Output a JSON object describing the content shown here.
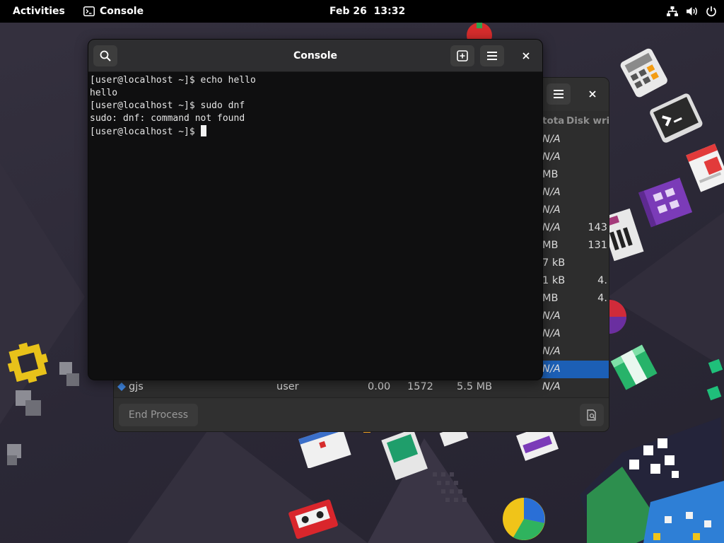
{
  "topbar": {
    "activities": "Activities",
    "app_name": "Console",
    "date": "Feb 26",
    "time": "13:32",
    "tray_icons": [
      "network-icon",
      "volume-icon",
      "power-icon"
    ]
  },
  "console": {
    "title": "Console",
    "lines": [
      "[user@localhost ~]$ echo hello",
      "hello",
      "[user@localhost ~]$ sudo dnf",
      "sudo: dnf: command not found",
      "[user@localhost ~]$ "
    ]
  },
  "sysmon": {
    "header_disk": "tota",
    "header_write": "Disk writ",
    "rows": [
      {
        "disk": "N/A",
        "write": ""
      },
      {
        "disk": "N/A",
        "write": ""
      },
      {
        "disk": "MB",
        "write": ""
      },
      {
        "disk": "N/A",
        "write": ""
      },
      {
        "disk": "N/A",
        "write": ""
      },
      {
        "disk": "N/A",
        "write": "143"
      },
      {
        "disk": "MB",
        "write": "131"
      },
      {
        "disk": "7 kB",
        "write": ""
      },
      {
        "disk": "1 kB",
        "write": "4."
      },
      {
        "disk": "MB",
        "write": "4."
      },
      {
        "disk": "N/A",
        "write": ""
      },
      {
        "disk": "N/A",
        "write": ""
      },
      {
        "disk": "N/A",
        "write": ""
      },
      {
        "disk": "N/A",
        "write": ""
      }
    ],
    "visible_process": {
      "name": "gjs",
      "user": "user",
      "cpu": "0.00",
      "id": "1572",
      "memory": "5.5 MB",
      "disk": "N/A"
    },
    "end_process_label": "End Process"
  },
  "colors": {
    "accent": "#1c5fb5",
    "topbar": "#000000",
    "terminal_bg": "#0f0f10"
  }
}
